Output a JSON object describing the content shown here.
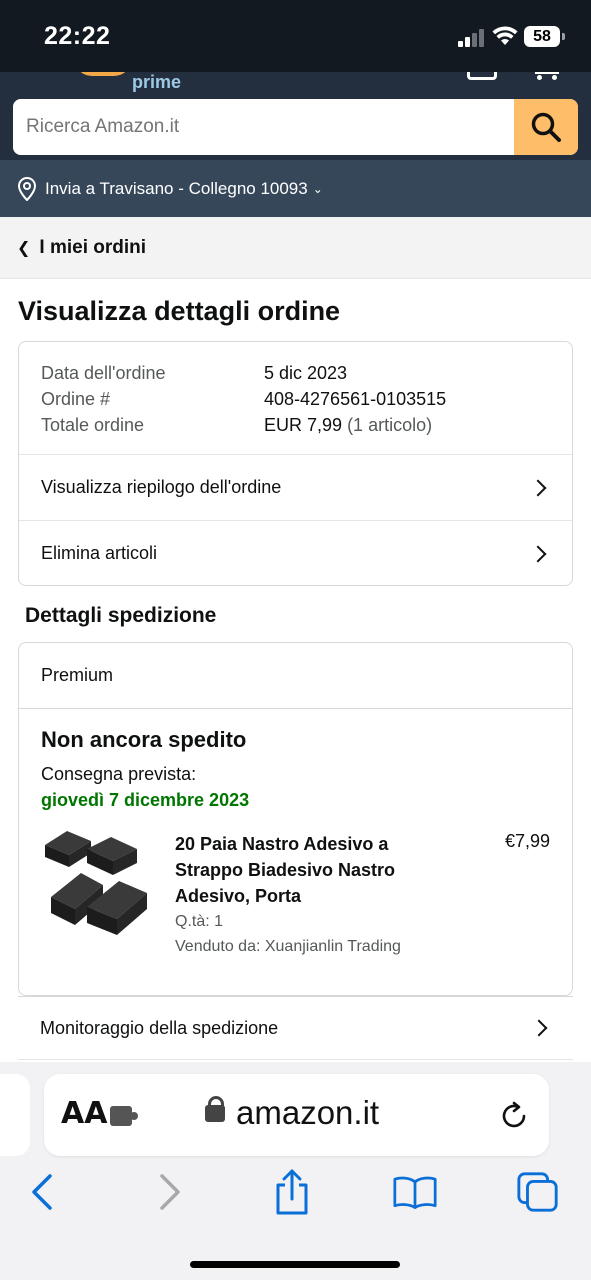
{
  "status_bar": {
    "time": "22:22",
    "battery": "58"
  },
  "header": {
    "prime_text": "prime"
  },
  "search": {
    "placeholder": "Ricerca Amazon.it"
  },
  "delivery": {
    "text": "Invia a Travisano - Collegno 10093"
  },
  "breadcrumb": {
    "label": "I miei ordini"
  },
  "page": {
    "title": "Visualizza dettagli ordine"
  },
  "order": {
    "date_label": "Data dell'ordine",
    "date_value": "5 dic 2023",
    "number_label": "Ordine #",
    "number_value": "408-4276561-0103515",
    "total_label": "Totale ordine",
    "total_value": "EUR 7,99",
    "total_count": "(1 articolo)"
  },
  "actions": {
    "summary": "Visualizza riepilogo dell'ordine",
    "delete": "Elimina articoli"
  },
  "shipping": {
    "section_title": "Dettagli spedizione",
    "speed": "Premium",
    "status": "Non ancora spedito",
    "expected_label": "Consegna prevista:",
    "expected_date": "giovedì 7 dicembre 2023",
    "item": {
      "title": "20 Paia Nastro Adesivo a Strappo Biadesivo Nastro Adesivo, Porta",
      "price": "€7,99",
      "qty": "Q.tà: 1",
      "seller": "Venduto da: Xuanjianlin Trading"
    },
    "tracking": "Monitoraggio della spedizione"
  },
  "browser": {
    "aa": "AA",
    "domain": "amazon.it"
  },
  "colors": {
    "header": "#232f3e",
    "deliver_bar": "#37475a",
    "search_button": "#febd69",
    "delivery_green": "#007600",
    "safari_blue": "#0a6fd6"
  }
}
